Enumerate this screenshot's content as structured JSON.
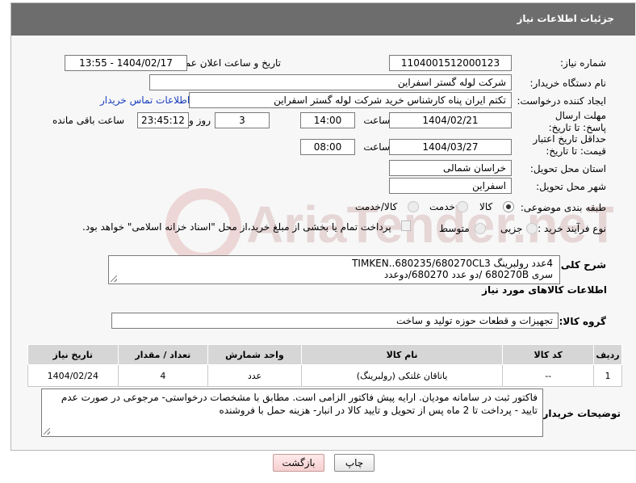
{
  "header": {
    "title": "جزئیات اطلاعات نیاز"
  },
  "fields": {
    "need_number_label": "شماره نیاز:",
    "need_number": "1104001512000123",
    "announce_label": "تاریخ و ساعت اعلان عمومی:",
    "announce_value": "1404/02/17 - 13:55",
    "buyer_org_label": "نام دستگاه خریدار:",
    "buyer_org": "شرکت لوله گستر اسفراین",
    "creator_label": "ایجاد کننده درخواست:",
    "creator": "تکتم ایران پناه کارشناس خرید شرکت لوله گستر اسفراین",
    "contact_link": "اطلاعات تماس خریدار",
    "deadline_label": "مهلت ارسال پاسخ: تا تاریخ:",
    "deadline_date": "1404/02/21",
    "time_label": "ساعت",
    "deadline_time": "14:00",
    "days": "3",
    "days_label": "روز و",
    "remaining": "23:45:12",
    "remaining_label": "ساعت باقی مانده",
    "min_price_label": "حداقل تاریخ اعتبار قیمت: تا تاریخ:",
    "price_date": "1404/03/27",
    "time_label2": "ساعت",
    "price_time": "08:00",
    "province_label": "استان محل تحویل:",
    "province": "خراسان شمالی",
    "city_label": "شهر محل تحویل:",
    "city": "اسفراین",
    "category_label": "طبقه بندی موضوعی:",
    "cat_goods": "کالا",
    "cat_service": "خدمت",
    "cat_goods_service": "کالا/خدمت",
    "process_label": "نوع فرآیند خرید :",
    "proc_partial": "جزیی",
    "proc_medium": "متوسط",
    "payment_note": "پرداخت تمام یا بخشی از مبلغ خرید،از محل \"اسناد خزانه اسلامی\" خواهد بود."
  },
  "description": {
    "label": "شرح کلی نیاز:",
    "line1": "4عدد        رولبرینگ TIMKEN..680235/680270CL3",
    "line2": "سری 680270B /دو عدد 680270/دوعدد"
  },
  "goods_info_title": "اطلاعات کالاهای مورد نیاز",
  "goods_group": {
    "label": "گروه کالا:",
    "value": "تجهیزات و قطعات حوزه تولید و ساخت"
  },
  "table": {
    "headers": [
      "ردیف",
      "کد کالا",
      "نام کالا",
      "واحد شمارش",
      "تعداد / مقدار",
      "تاریخ نیاز"
    ],
    "rows": [
      [
        "1",
        "--",
        "یاتاقان غلتکی (رولبرینگ)",
        "عدد",
        "4",
        "1404/02/24"
      ]
    ]
  },
  "buyer_notes": {
    "label": "توضیحات خریدار:",
    "text": "فاکتور ثبت در سامانه مودیان. ارایه پیش فاکتور الزامی است. مطابق با مشخصات درخواستی- مرجوعی در صورت عدم تایید - پرداخت تا 2 ماه پس از تحویل و تایید کالا در انبار- هزینه حمل با فروشنده"
  },
  "buttons": {
    "print": "چاپ",
    "back": "بازگشت"
  },
  "watermark": "AriaTender.neT",
  "colors": {
    "header": "#6d6d6d",
    "link": "#1a3dbf",
    "back_button": "#f6cfcf"
  }
}
